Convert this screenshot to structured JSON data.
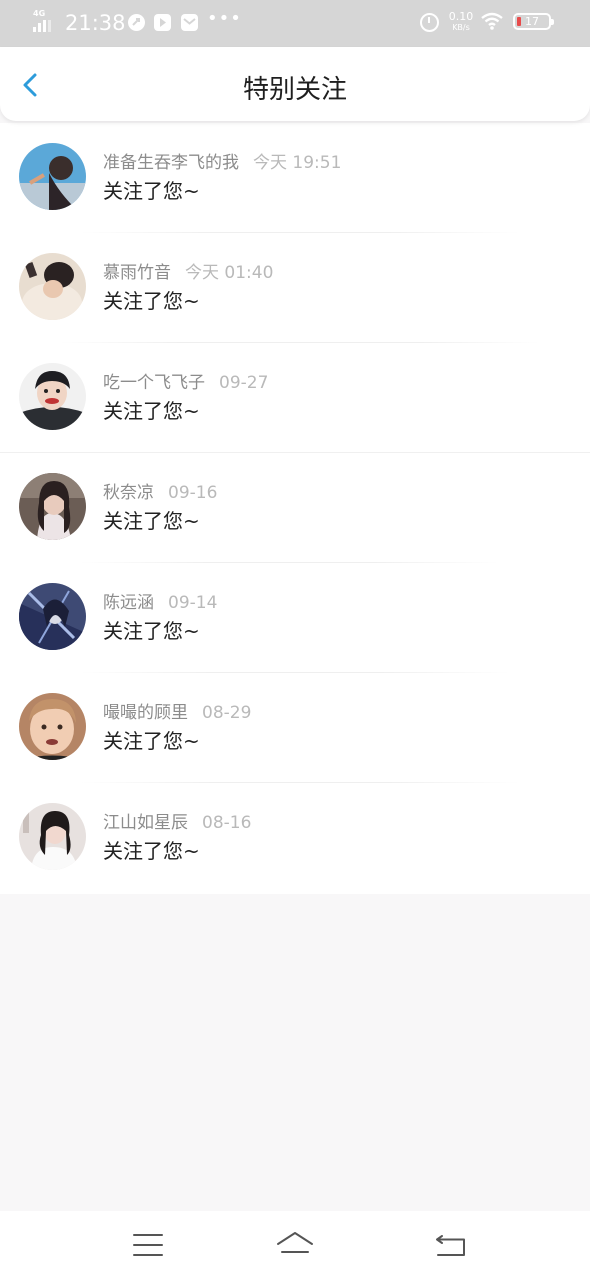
{
  "status_bar": {
    "network": "4G",
    "time": "21:38",
    "speed_value": "0.10",
    "speed_unit": "KB/s",
    "battery": "17",
    "icons": [
      "signal-icon",
      "clock-app-icon",
      "video-app-icon",
      "mail-app-icon",
      "more-dots-icon",
      "alarm-icon",
      "wifi-icon",
      "battery-icon"
    ]
  },
  "header": {
    "title": "特别关注",
    "back_icon": "chevron-left-icon"
  },
  "colors": {
    "accent": "#2d9cdb",
    "status_bar_bg": "#d6d6d6",
    "page_bg": "#f8f7f8",
    "name_text": "#8c8c8c",
    "time_text": "#b9b9b9",
    "message_text": "#222222"
  },
  "notifications": [
    {
      "name": "准备生吞李飞的我",
      "time": "今天 19:51",
      "message": "关注了您~",
      "avatar": "avatar-photo"
    },
    {
      "name": "慕雨竹音",
      "time": "今天 01:40",
      "message": "关注了您~",
      "avatar": "avatar-photo"
    },
    {
      "name": "吃一个飞飞子",
      "time": "09-27",
      "message": "关注了您~",
      "avatar": "avatar-photo"
    },
    {
      "name": "秋奈凉",
      "time": "09-16",
      "message": "关注了您~",
      "avatar": "avatar-photo"
    },
    {
      "name": "陈远涵",
      "time": "09-14",
      "message": "关注了您~",
      "avatar": "avatar-photo"
    },
    {
      "name": "嘬嘬的顾里",
      "time": "08-29",
      "message": "关注了您~",
      "avatar": "avatar-photo"
    },
    {
      "name": "江山如星辰",
      "time": "08-16",
      "message": "关注了您~",
      "avatar": "avatar-photo"
    }
  ],
  "nav_bar": {
    "icons": [
      "menu-icon",
      "home-icon",
      "back-icon"
    ]
  }
}
